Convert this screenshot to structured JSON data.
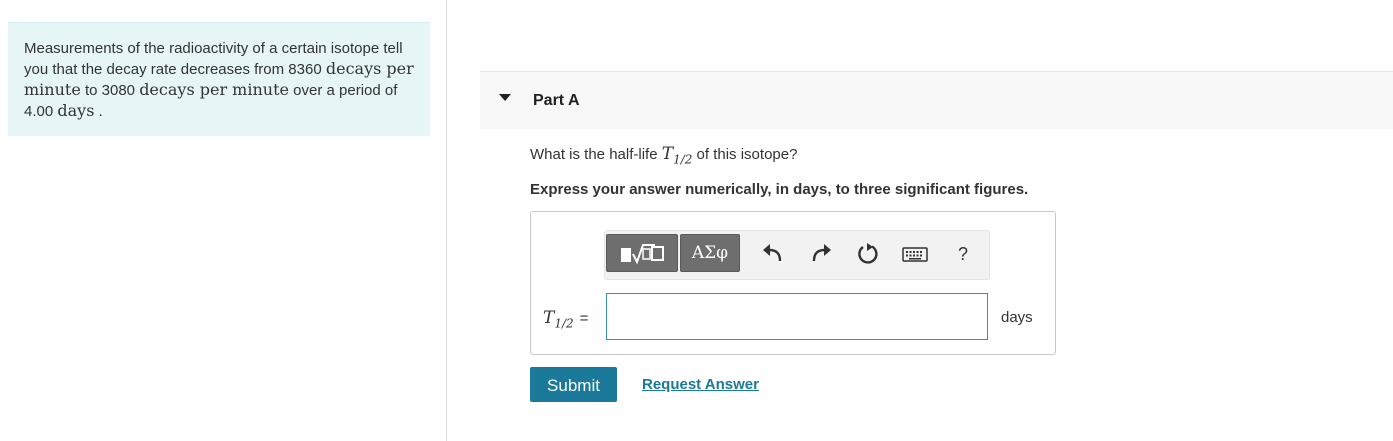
{
  "problem": {
    "line1": "Measurements of the radioactivity of a certain isotope tell you that the decay rate decreases from 8360 ",
    "unit1": "decays per minute",
    "mid": " to 3080 ",
    "unit2": "decays per minute",
    "line3": " over a period of 4.00 ",
    "unit3": "days",
    "end": " ."
  },
  "part": {
    "title": "Part A"
  },
  "question": {
    "prefix": "What is the half-life ",
    "symbol": "T",
    "subscript": "1/2",
    "suffix": " of this isotope?"
  },
  "instruction": "Express your answer numerically, in days, to three significant figures.",
  "toolbar": {
    "symbols_label": "ΑΣφ",
    "help_label": "?"
  },
  "answer": {
    "var_symbol": "T",
    "var_subscript": "1/2",
    "equals": "=",
    "value": "",
    "unit": "days"
  },
  "actions": {
    "submit_label": "Submit",
    "request_label": "Request Answer"
  },
  "colors": {
    "accent": "#1b7a99",
    "problem_bg": "#e6f6f7",
    "toolbar_button": "#6e6e6e"
  }
}
